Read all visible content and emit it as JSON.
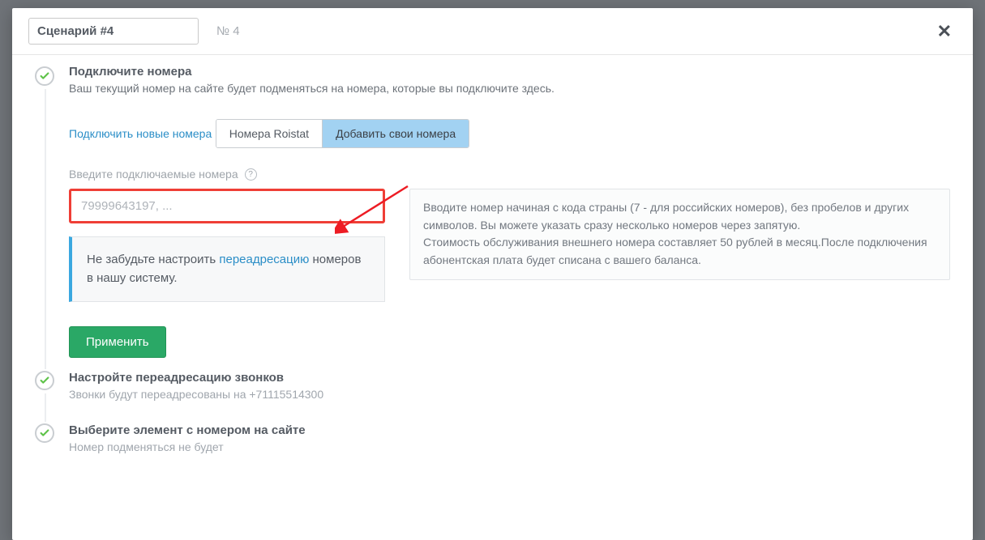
{
  "header": {
    "title": "Сценарий #4",
    "number": "№ 4"
  },
  "step1": {
    "title": "Подключите номера",
    "desc": "Ваш текущий номер на сайте будет подменяться на номера, которые вы подключите здесь.",
    "link": "Подключить новые номера",
    "tab1": "Номера Roistat",
    "tab2": "Добавить свои номера",
    "field_label": "Введите подключаемые номера",
    "placeholder": "79999643197, ...",
    "notice_text1": "Не забудьте настроить ",
    "notice_link": "переадресацию",
    "notice_text2": " номеров в нашу систему.",
    "info": "Вводите номер начиная с кода страны (7 - для российских номеров), без пробелов и других символов. Вы можете указать сразу несколько номеров через запятую.\nСтоимость обслуживания внешнего номера составляет 50 рублей в месяц.После подключения абонентская плата будет списана с вашего баланса.",
    "apply": "Применить"
  },
  "step2": {
    "title": "Настройте переадресацию звонков",
    "desc": "Звонки будут переадресованы на +71115514300"
  },
  "step3": {
    "title": "Выберите элемент с номером на сайте",
    "desc": "Номер подменяться не будет"
  }
}
